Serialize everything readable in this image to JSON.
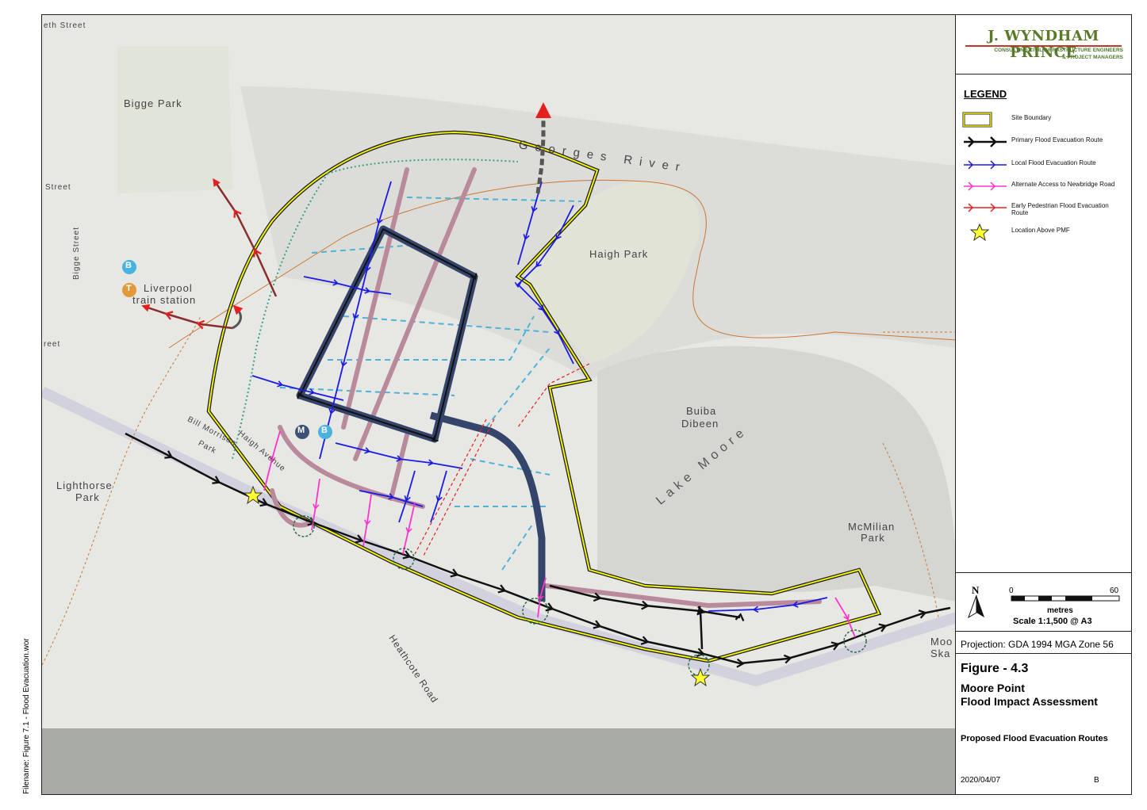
{
  "logo": {
    "name": "J. WYNDHAM PRINCE",
    "line1": "CONSULTING CIVIL INFRASTRUCTURE ENGINEERS",
    "line2": "& PROJECT MANAGERS"
  },
  "legend": {
    "title": "LEGEND",
    "items": [
      {
        "symbol": "site-boundary",
        "label": "Site Boundary",
        "color": "#f2f20a"
      },
      {
        "symbol": "primary-route",
        "label": "Primary Flood Evacuation Route",
        "color": "#111111"
      },
      {
        "symbol": "local-route",
        "label": "Local Flood Evacuation Route",
        "color": "#1a1ae6"
      },
      {
        "symbol": "alternate-access",
        "label": "Alternate Access to Newbridge Road",
        "color": "#ff33cc"
      },
      {
        "symbol": "pedestrian-route",
        "label": "Early Pedestrian Flood Evacuation Route",
        "color": "#e62020"
      },
      {
        "symbol": "location-above-pmf",
        "label": "Location Above PMF",
        "color": "#ffff33"
      }
    ]
  },
  "scale": {
    "start": "0",
    "end": "60",
    "unit": "metres",
    "text": "Scale 1:1,500 @ A3",
    "north": "N"
  },
  "projection": "Projection: GDA 1994 MGA Zone 56",
  "figure": {
    "number": "Figure - 4.3",
    "title_line1": "Moore Point",
    "title_line2": "Flood Impact Assessment",
    "subtitle": "Proposed Flood Evacuation Routes",
    "date": "2020/04/07",
    "revision": "B"
  },
  "filename": "Filename:  Figure 7.1 - Flood Evacuation.wor",
  "map_labels": {
    "street_top": "eth Street",
    "bigge_park": "Bigge Park",
    "street_left1": "Street",
    "bigge_street": "Bigge Street",
    "station_line1": "Liverpool",
    "station_line2": "train station",
    "street_left2": "reet",
    "georges_river": "Georges River",
    "haigh_park": "Haigh Park",
    "buiba_line1": "Buiba",
    "buiba_line2": "Dibeen",
    "lake_moore": "Lake Moore",
    "bill_line1": "Bill Morrison",
    "bill_line2": "Park",
    "haigh_avenue": "Haigh Avenue",
    "lighthorse_line1": "Lighthorse",
    "lighthorse_line2": "Park",
    "mcmilian_line1": "McMilian",
    "mcmilian_line2": "Park",
    "heathcote_road": "Heathcote Road",
    "moo_line1": "Moo",
    "moo_line2": "Ska",
    "badge_b": "B",
    "badge_t": "T",
    "badge_m": "M"
  }
}
